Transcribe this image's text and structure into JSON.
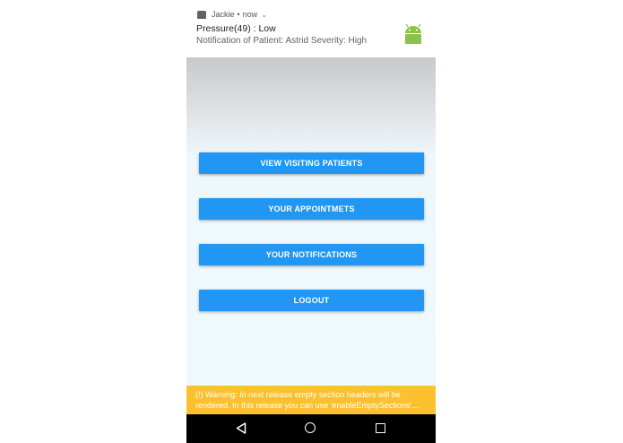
{
  "notification": {
    "app_name": "Jackie",
    "separator": "•",
    "time": "now",
    "title": "Pressure(49) : Low",
    "body": "Notification of Patient: Astrid Severity: High",
    "icon": "android-icon",
    "icon_color": "#8bc34a"
  },
  "menu": {
    "buttons": [
      {
        "label": "VIEW VISITING PATIENTS"
      },
      {
        "label": "YOUR APPOINTMETS"
      },
      {
        "label": "YOUR NOTIFICATIONS"
      },
      {
        "label": "LOGOUT"
      }
    ],
    "button_color": "#2196f3"
  },
  "warning": {
    "text": "(!) Warning: In next release empty section headers will be rendered. In this release you can use 'enableEmptySections'..."
  },
  "navbar": {
    "back_icon": "back-triangle-icon",
    "home_icon": "home-circle-icon",
    "recent_icon": "recent-square-icon"
  }
}
